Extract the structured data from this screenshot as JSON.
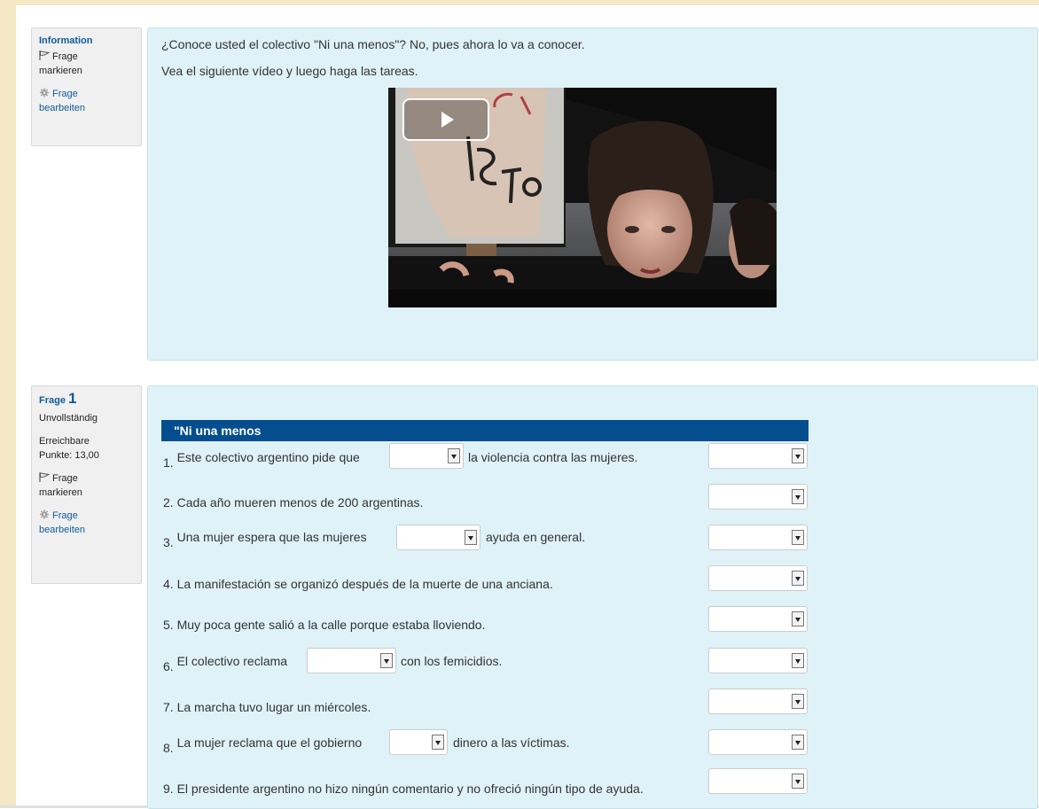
{
  "info_block": {
    "title": "Information",
    "flag_line1": "Frage",
    "flag_line2": "markieren",
    "edit_line1": "Frage",
    "edit_line2": "bearbeiten"
  },
  "intro": {
    "line1": "¿Conoce usted el colectivo \"Ni una menos\"? No, pues ahora lo va a conocer.",
    "line2": "Vea el siguiente vídeo y luego haga las tareas."
  },
  "question_block": {
    "title_prefix": "Frage",
    "number": "1",
    "status": "Unvollständig",
    "points_line1": "Erreichbare",
    "points_line2": "Punkte: 13,00",
    "flag_line1": "Frage",
    "flag_line2": "markieren",
    "edit_line1": "Frage",
    "edit_line2": "bearbeiten"
  },
  "quiz": {
    "header": "\"Ni una menos",
    "items": [
      {
        "num": "1.",
        "before": "Este colectivo argentino pide que",
        "after": "la violencia contra las mujeres."
      },
      {
        "num": "2.",
        "text": "Cada año mueren menos de 200 argentinas."
      },
      {
        "num": "3.",
        "before": "Una mujer espera que las mujeres",
        "after": "ayuda en general."
      },
      {
        "num": "4.",
        "text": "La manifestación se organizó después de la muerte de una anciana."
      },
      {
        "num": "5.",
        "text": "Muy poca gente salió a la calle porque estaba lloviendo."
      },
      {
        "num": "6.",
        "before": "El colectivo reclama",
        "after": "con los femicidios."
      },
      {
        "num": "7.",
        "text": "La marcha tuvo lugar un miércoles."
      },
      {
        "num": "8.",
        "before": "La mujer reclama que el gobierno",
        "after": "dinero a las víctimas."
      },
      {
        "num": "9.",
        "text": "El presidente argentino no hizo ningún comentario y no ofreció ningún tipo de ayuda."
      }
    ]
  },
  "colors": {
    "accent": "#044e8f",
    "panel": "#def2f8",
    "sidebar": "#f4e7c3"
  }
}
